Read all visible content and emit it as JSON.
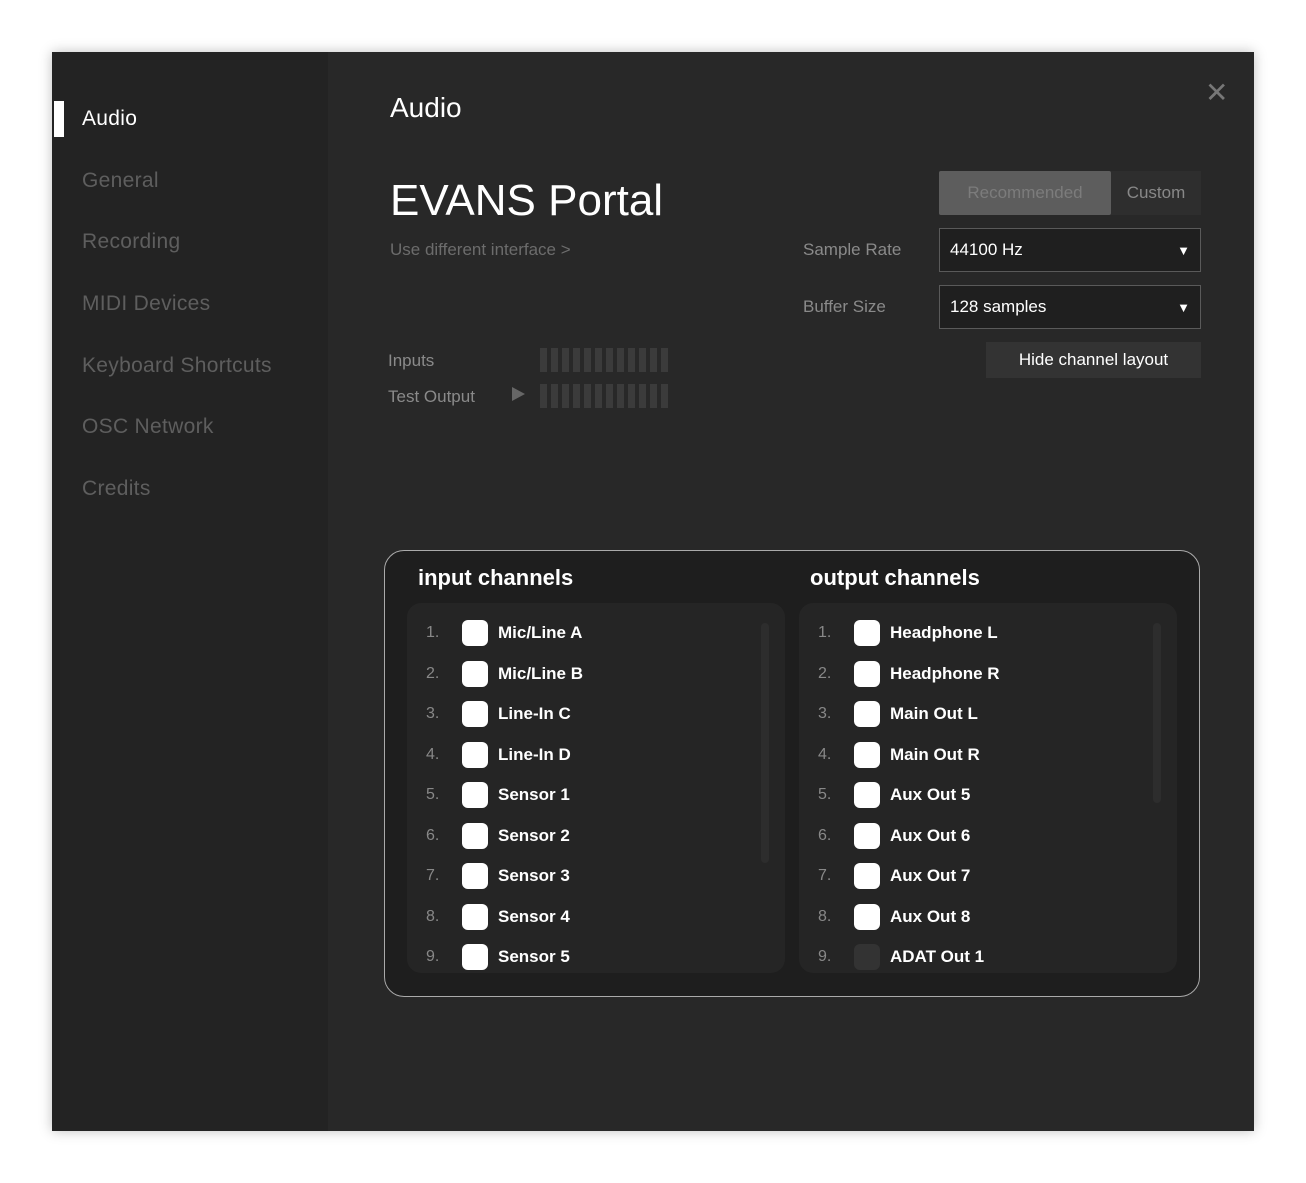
{
  "sidebar": {
    "items": [
      {
        "label": "Audio",
        "active": true
      },
      {
        "label": "General"
      },
      {
        "label": "Recording"
      },
      {
        "label": "MIDI Devices"
      },
      {
        "label": "Keyboard Shortcuts"
      },
      {
        "label": "OSC Network"
      },
      {
        "label": "Credits"
      }
    ]
  },
  "header": {
    "title": "Audio",
    "close_icon": "close-icon"
  },
  "device": {
    "name": "EVANS Portal",
    "change_link": "Use different interface >"
  },
  "mode": {
    "options": [
      "Recommended",
      "Custom"
    ],
    "selected": "Recommended"
  },
  "settings": {
    "sample_rate_label": "Sample Rate",
    "sample_rate": "44100 Hz",
    "buffer_size_label": "Buffer Size",
    "buffer_size": "128 samples"
  },
  "hide_channel_layout": "Hide channel layout",
  "meters": {
    "inputs_label": "Inputs",
    "test_output_label": "Test Output"
  },
  "channels": {
    "input_title": "input channels",
    "output_title": "output channels",
    "inputs": [
      {
        "num": "1.",
        "name": "Mic/Line A",
        "checked": true
      },
      {
        "num": "2.",
        "name": "Mic/Line B",
        "checked": true
      },
      {
        "num": "3.",
        "name": "Line-In C",
        "checked": true
      },
      {
        "num": "4.",
        "name": "Line-In D",
        "checked": true
      },
      {
        "num": "5.",
        "name": "Sensor 1",
        "checked": true
      },
      {
        "num": "6.",
        "name": "Sensor 2",
        "checked": true
      },
      {
        "num": "7.",
        "name": "Sensor 3",
        "checked": true
      },
      {
        "num": "8.",
        "name": "Sensor 4",
        "checked": true
      },
      {
        "num": "9.",
        "name": "Sensor 5",
        "checked": true
      }
    ],
    "outputs": [
      {
        "num": "1.",
        "name": "Headphone L",
        "checked": true
      },
      {
        "num": "2.",
        "name": "Headphone R",
        "checked": true
      },
      {
        "num": "3.",
        "name": "Main Out L",
        "checked": true
      },
      {
        "num": "4.",
        "name": "Main Out R",
        "checked": true
      },
      {
        "num": "5.",
        "name": "Aux Out 5",
        "checked": true
      },
      {
        "num": "6.",
        "name": "Aux Out 6",
        "checked": true
      },
      {
        "num": "7.",
        "name": "Aux Out 7",
        "checked": true
      },
      {
        "num": "8.",
        "name": "Aux Out 8",
        "checked": true
      },
      {
        "num": "9.",
        "name": "ADAT Out 1",
        "checked": false
      }
    ]
  }
}
